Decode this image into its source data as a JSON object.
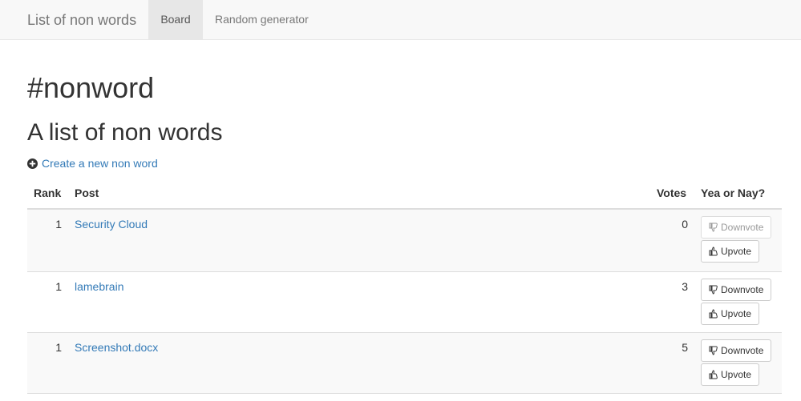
{
  "navbar": {
    "brand": "List of non words",
    "tabs": [
      {
        "label": "Board",
        "active": true
      },
      {
        "label": "Random generator",
        "active": false
      }
    ]
  },
  "main": {
    "title": "#nonword",
    "subtitle": "A list of non words",
    "create_link": {
      "label": "Create a new non word",
      "icon": "plus-circle-icon"
    }
  },
  "table": {
    "headers": {
      "rank": "Rank",
      "post": "Post",
      "votes": "Votes",
      "vote": "Yea or Nay?"
    },
    "rows": [
      {
        "rank": "1",
        "post": "Security Cloud",
        "votes": "0",
        "downvote": "Downvote",
        "upvote": "Upvote",
        "downvote_disabled": true
      },
      {
        "rank": "1",
        "post": "lamebrain",
        "votes": "3",
        "downvote": "Downvote",
        "upvote": "Upvote",
        "downvote_disabled": false
      },
      {
        "rank": "1",
        "post": "Screenshot.docx",
        "votes": "5",
        "downvote": "Downvote",
        "upvote": "Upvote",
        "downvote_disabled": false
      }
    ]
  },
  "colors": {
    "link": "#337ab7",
    "navbar_bg": "#f8f8f8",
    "active_tab_bg": "#e7e7e7",
    "stripe_bg": "#f9f9f9"
  }
}
